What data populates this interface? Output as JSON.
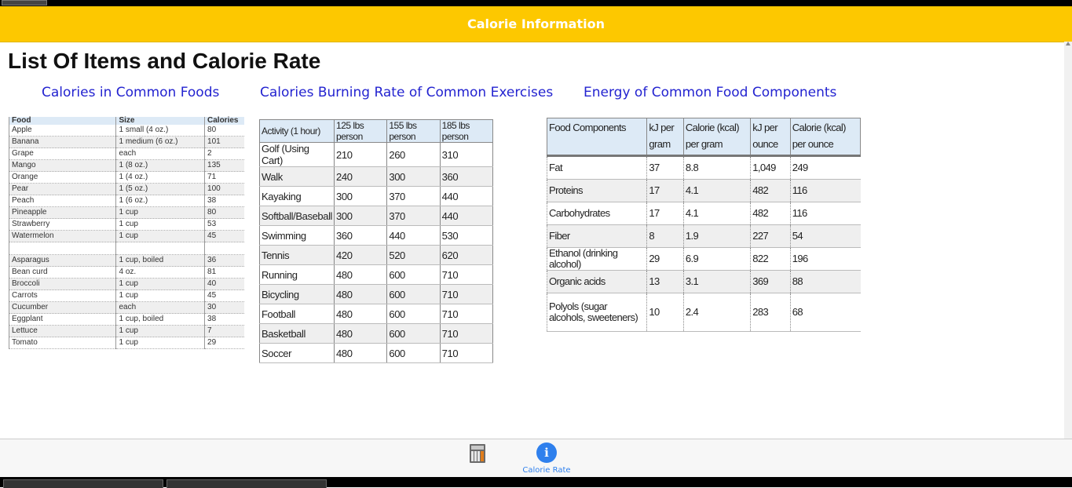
{
  "header": {
    "title": "Calorie Information"
  },
  "page": {
    "title": "List Of Items and Calorie Rate",
    "sections": [
      "Calories in Common Foods",
      "Calories Burning Rate of Common Exercises",
      "Energy of Common Food Components"
    ]
  },
  "foods": {
    "headers": [
      "Food",
      "Size",
      "Calories"
    ],
    "rows": [
      [
        "Apple",
        "1 small (4 oz.)",
        "80"
      ],
      [
        "Banana",
        "1 medium (6 oz.)",
        "101"
      ],
      [
        "Grape",
        "each",
        "2"
      ],
      [
        "Mango",
        "1 (8 oz.)",
        "135"
      ],
      [
        "Orange",
        "1 (4 oz.)",
        "71"
      ],
      [
        "Pear",
        "1 (5 oz.)",
        "100"
      ],
      [
        "Peach",
        "1 (6 oz.)",
        "38"
      ],
      [
        "Pineapple",
        "1 cup",
        "80"
      ],
      [
        "Strawberry",
        "1 cup",
        "53"
      ],
      [
        "Watermelon",
        "1 cup",
        "45"
      ],
      [
        "",
        "",
        ""
      ],
      [
        "Asparagus",
        "1 cup, boiled",
        "36"
      ],
      [
        "Bean curd",
        "4 oz.",
        "81"
      ],
      [
        "Broccoli",
        "1 cup",
        "40"
      ],
      [
        "Carrots",
        "1 cup",
        "45"
      ],
      [
        "Cucumber",
        "each",
        "30"
      ],
      [
        "Eggplant",
        "1 cup, boiled",
        "38"
      ],
      [
        "Lettuce",
        "1 cup",
        "7"
      ],
      [
        "Tomato",
        "1 cup",
        "29"
      ]
    ]
  },
  "exercises": {
    "headers": [
      "Activity (1 hour)",
      "125 lbs person",
      "155 lbs person",
      "185 lbs person"
    ],
    "rows": [
      [
        "Golf (Using Cart)",
        "210",
        "260",
        "310"
      ],
      [
        "Walk",
        "240",
        "300",
        "360"
      ],
      [
        "Kayaking",
        "300",
        "370",
        "440"
      ],
      [
        "Softball/Baseball",
        "300",
        "370",
        "440"
      ],
      [
        "Swimming",
        "360",
        "440",
        "530"
      ],
      [
        "Tennis",
        "420",
        "520",
        "620"
      ],
      [
        "Running",
        "480",
        "600",
        "710"
      ],
      [
        "Bicycling",
        "480",
        "600",
        "710"
      ],
      [
        "Football",
        "480",
        "600",
        "710"
      ],
      [
        "Basketball",
        "480",
        "600",
        "710"
      ],
      [
        "Soccer",
        "480",
        "600",
        "710"
      ]
    ]
  },
  "components": {
    "headers": [
      "Food Components",
      "kJ per gram",
      "Calorie (kcal) per gram",
      "kJ per ounce",
      "Calorie (kcal) per ounce"
    ],
    "rows": [
      [
        "Fat",
        "37",
        "8.8",
        "1,049",
        "249"
      ],
      [
        "Proteins",
        "17",
        "4.1",
        "482",
        "116"
      ],
      [
        "Carbohydrates",
        "17",
        "4.1",
        "482",
        "116"
      ],
      [
        "Fiber",
        "8",
        "1.9",
        "227",
        "54"
      ],
      [
        "Ethanol (drinking alcohol)",
        "29",
        "6.9",
        "822",
        "196"
      ],
      [
        "Organic acids",
        "13",
        "3.1",
        "369",
        "88"
      ],
      [
        "Polyols (sugar alcohols, sweeteners)",
        "10",
        "2.4",
        "283",
        "68"
      ]
    ]
  },
  "footer": {
    "tabs": [
      {
        "icon": "calculator-icon",
        "label": ""
      },
      {
        "icon": "info-icon",
        "label": "Calorie Rate"
      }
    ],
    "active_color": "#2f80ed"
  },
  "colors": {
    "header_bg": "#fdc800",
    "link": "#2323d0",
    "table_header": "#ddeaf6"
  }
}
